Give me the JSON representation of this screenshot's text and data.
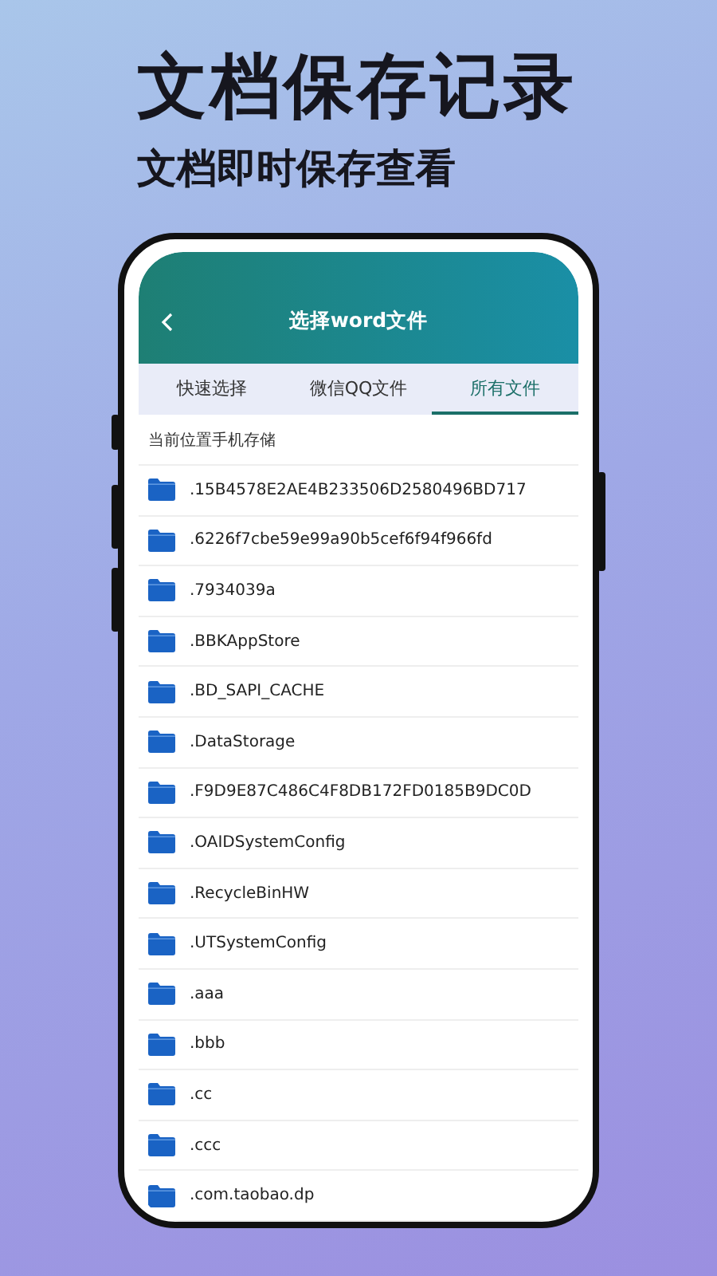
{
  "headline": {
    "title": "文档保存记录",
    "subtitle": "文档即时保存查看"
  },
  "app_bar": {
    "title": "选择word文件"
  },
  "tabs": [
    {
      "label": "快速选择",
      "selected": false
    },
    {
      "label": "微信QQ文件",
      "selected": false
    },
    {
      "label": "所有文件",
      "selected": true
    }
  ],
  "location_label": "当前位置手机存储",
  "folders": [
    {
      "name": ".15B4578E2AE4B233506D2580496BD717"
    },
    {
      "name": ".6226f7cbe59e99a90b5cef6f94f966fd"
    },
    {
      "name": ".7934039a"
    },
    {
      "name": ".BBKAppStore"
    },
    {
      "name": ".BD_SAPI_CACHE"
    },
    {
      "name": ".DataStorage"
    },
    {
      "name": ".F9D9E87C486C4F8DB172FD0185B9DC0D"
    },
    {
      "name": ".OAIDSystemConfig"
    },
    {
      "name": ".RecycleBinHW"
    },
    {
      "name": ".UTSystemConfig"
    },
    {
      "name": ".aaa"
    },
    {
      "name": ".bbb"
    },
    {
      "name": ".cc"
    },
    {
      "name": ".ccc"
    },
    {
      "name": ".com.taobao.dp"
    }
  ]
}
